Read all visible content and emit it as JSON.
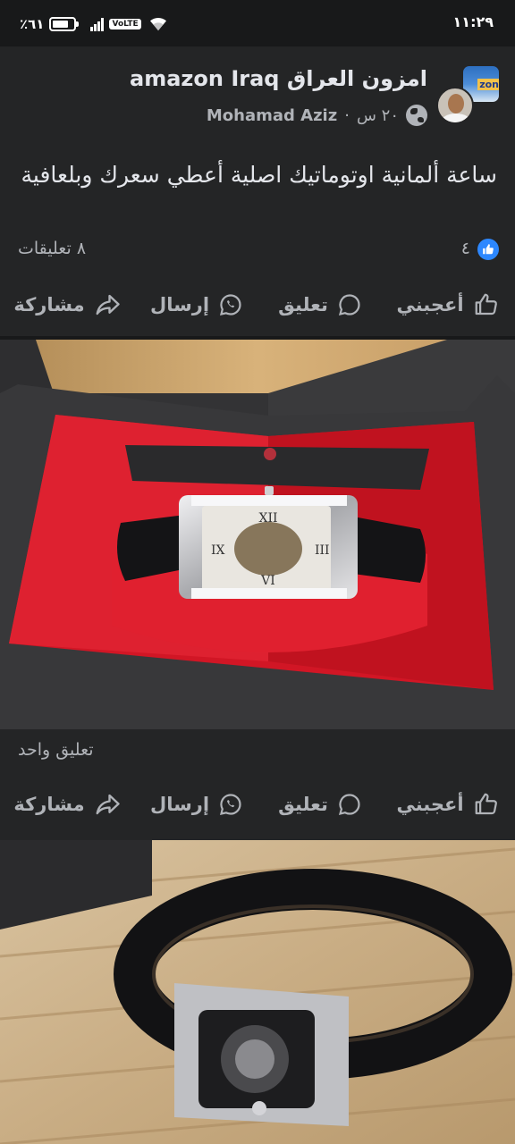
{
  "status_bar": {
    "time": "١١:٢٩",
    "battery": "٪٦١",
    "network": "VoLTE"
  },
  "post": {
    "page_name": "امزون العراق amazon Iraq",
    "author": "Mohamad Aziz",
    "time": "٢٠ س",
    "separator": "·",
    "text": "ساعة ألمانية اوتوماتيك اصلية أعطي سعرك وبلعافية",
    "reactions_count": "٤",
    "comments_count": "٨ تعليقات",
    "avatar_logo": "zon"
  },
  "actions": {
    "like": "أعجبني",
    "comment": "تعليق",
    "send": "إرسال",
    "share": "مشاركة"
  },
  "photo1": {
    "comments_text": "تعليق واحد"
  },
  "icons": {
    "like": "thumbs-up-icon",
    "comment": "comment-bubble-icon",
    "send": "whatsapp-icon",
    "share": "share-arrow-icon",
    "privacy": "globe-icon",
    "reaction": "like-reaction-icon"
  },
  "colors": {
    "background": "#18191a",
    "card": "#242526",
    "text_primary": "#e4e6eb",
    "text_secondary": "#b0b3b8",
    "like_blue": "#2d88ff"
  }
}
